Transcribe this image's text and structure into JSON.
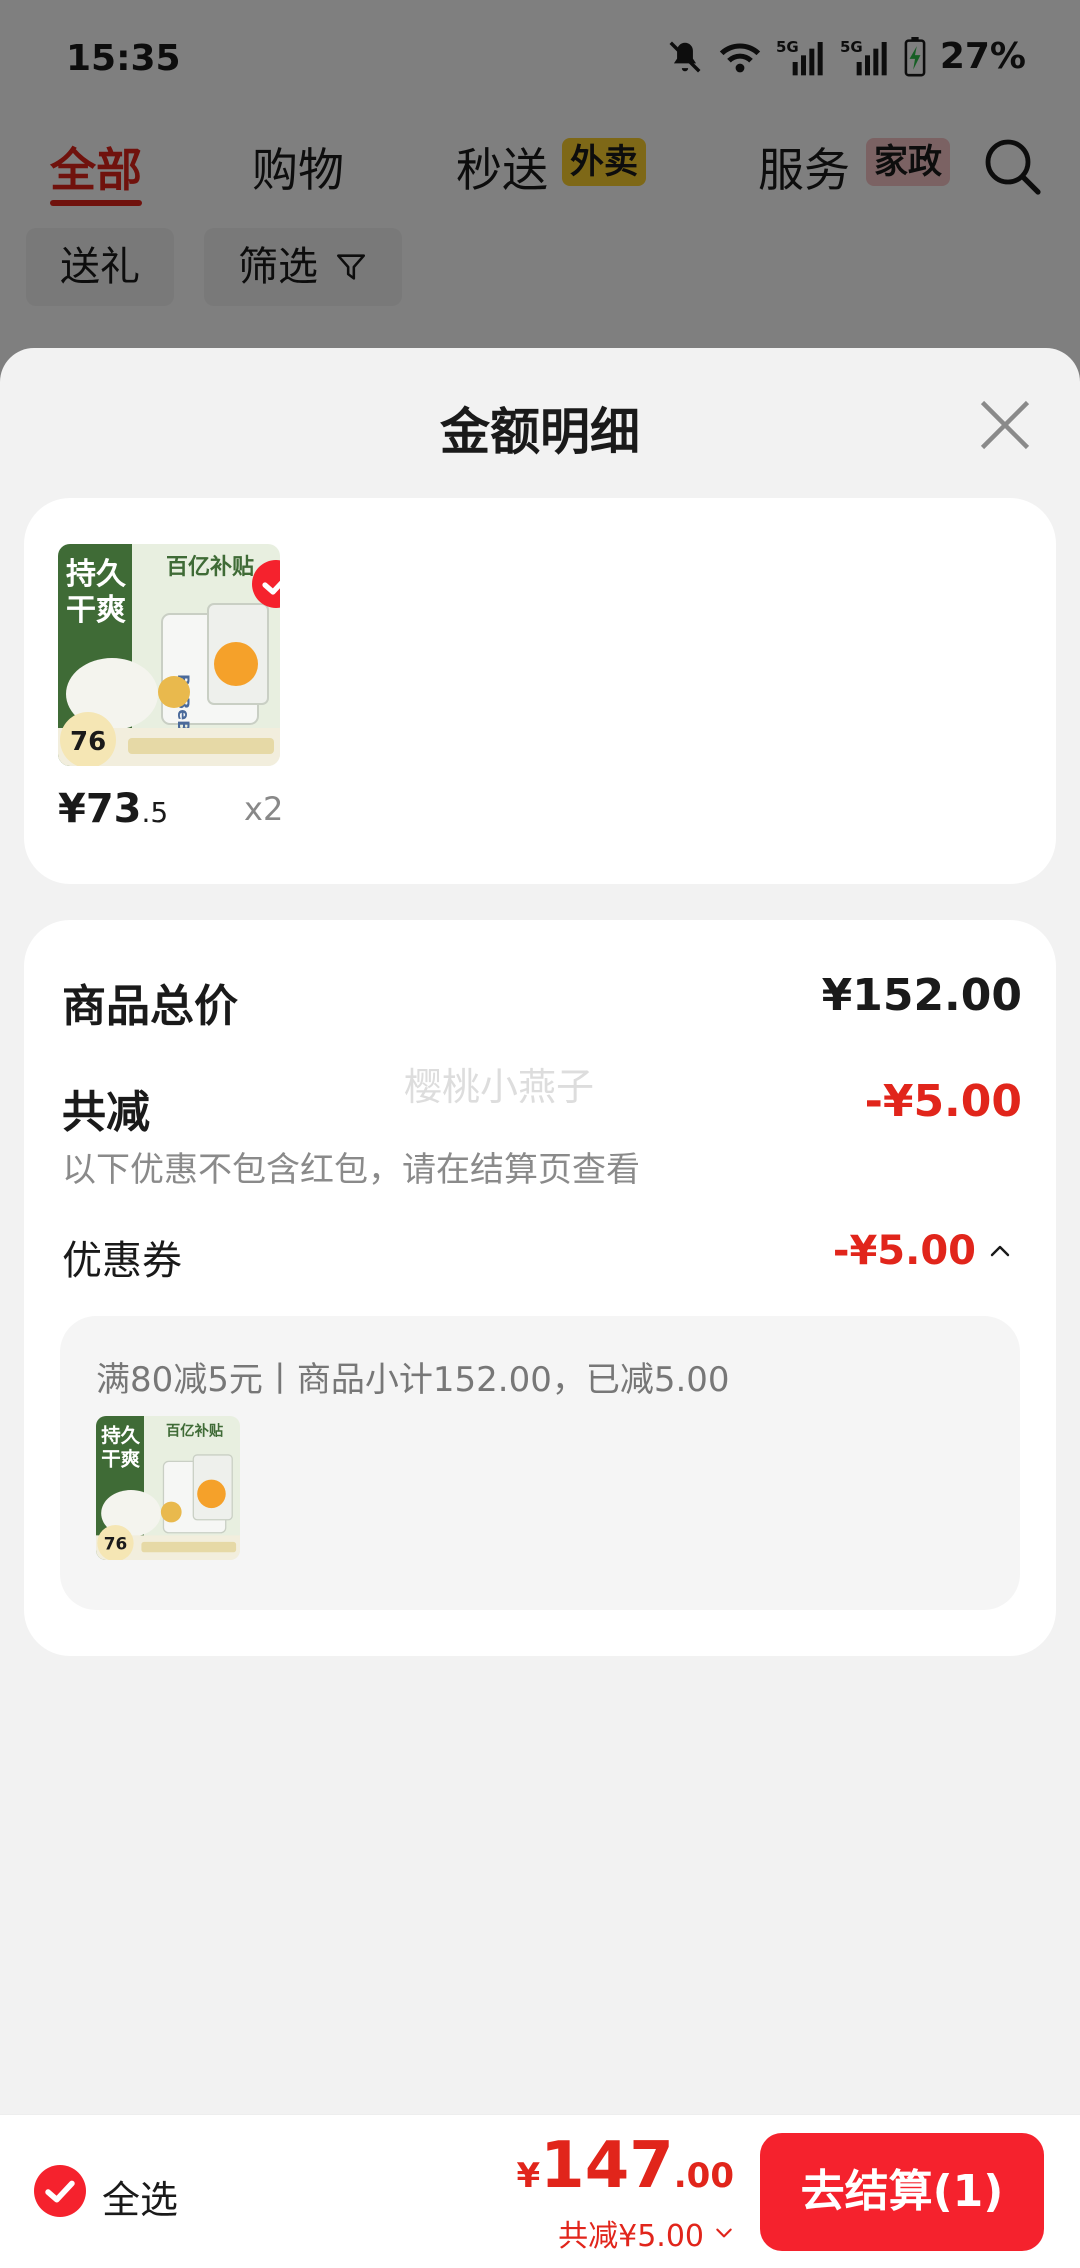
{
  "status_bar": {
    "time": "15:35",
    "network_1": "5G",
    "network_2": "5G",
    "battery": "27%",
    "icons": [
      "bell-off-icon",
      "wifi-icon",
      "signal-icon",
      "signal-icon",
      "battery-charging-icon"
    ]
  },
  "top_tabs": [
    {
      "label": "全部",
      "active": true
    },
    {
      "label": "购物",
      "active": false
    },
    {
      "label": "秒送",
      "badge": "外卖",
      "active": false
    },
    {
      "label": "服务",
      "badge": "家政",
      "active": false
    }
  ],
  "filter_chips": {
    "gift": "送礼",
    "filter": "筛选"
  },
  "sheet": {
    "title": "金额明细",
    "product": {
      "thumb_text_1": "持久",
      "thumb_text_2": "干爽",
      "thumb_brand": "百亿补贴",
      "thumb_pack": "BeBeBus",
      "thumb_count": "76",
      "price_int": "¥73",
      "price_dec": ".5",
      "quantity": "x2"
    },
    "detail": {
      "subtotal_label": "商品总价",
      "subtotal_value": "¥152.00",
      "discount_label": "共减",
      "discount_value": "-¥5.00",
      "discount_note": "以下优惠不包含红包，请在结算页查看",
      "coupon_label": "优惠券",
      "coupon_value": "-¥5.00",
      "coupon_desc": "满80减5元丨商品小计152.00，已减5.00",
      "watermark": "樱桃小燕子"
    }
  },
  "bottom_bar": {
    "select_all": "全选",
    "total_currency": "¥",
    "total_int": "147",
    "total_dec": ".00",
    "total_discount": "共减¥5.00",
    "checkout": "去结算(1)"
  },
  "colors": {
    "accent": "#e1251b",
    "checkout_button": "#f5222d",
    "sheet_bg": "#f2f2f2"
  }
}
